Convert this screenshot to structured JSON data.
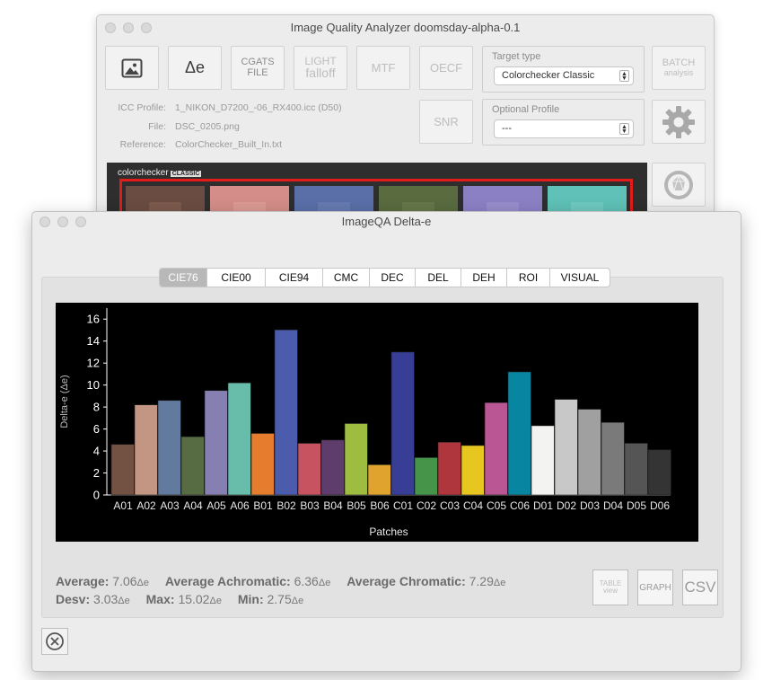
{
  "main_window": {
    "title": "Image Quality Analyzer doomsday-alpha-0.1",
    "toolbar": {
      "deltae_label": "Δe",
      "cgats_line1": "CGATS",
      "cgats_line2": "FILE",
      "light_line1": "LIGHT",
      "light_line2": "falloff",
      "mtf_label": "MTF",
      "oecf_label": "OECF",
      "snr_label": "SNR",
      "batch_line1": "BATCH",
      "batch_line2": "analysis"
    },
    "target_type": {
      "label": "Target type",
      "value": "Colorchecker Classic"
    },
    "optional_profile": {
      "label": "Optional Profile",
      "value": "---"
    },
    "info": {
      "icc_label": "ICC Profile:",
      "icc_value": "1_NIKON_D7200_-06_RX400.icc (D50)",
      "file_label": "File:",
      "file_value": "DSC_0205.png",
      "ref_label": "Reference:",
      "ref_value": "ColorChecker_Built_In.txt"
    },
    "preview": {
      "brand": "colorchecker",
      "brand_tag": "CLASSIC"
    }
  },
  "deltae_window": {
    "title": "ImageQA Delta-e",
    "tabs": [
      "CIE76",
      "CIE00",
      "CIE94",
      "CMC",
      "DEC",
      "DEL",
      "DEH",
      "ROI",
      "VISUAL"
    ],
    "selected_tab": "CIE76",
    "stats": {
      "average_label": "Average:",
      "average_value": "7.06",
      "avg_achromatic_label": "Average Achromatic:",
      "avg_achromatic_value": "6.36",
      "avg_chromatic_label": "Average Chromatic:",
      "avg_chromatic_value": "7.29",
      "desv_label": "Desv:",
      "desv_value": "3.03",
      "max_label": "Max:",
      "max_value": "15.02",
      "min_label": "Min:",
      "min_value": "2.75",
      "unit": "Δe"
    },
    "buttons": {
      "table_line1": "TABLE",
      "table_line2": "view",
      "graph": "GRAPH",
      "csv": "CSV"
    }
  },
  "colors": {
    "accent_red": "#e21b1b",
    "chart_bg": "#000000"
  },
  "chart_data": {
    "type": "bar",
    "xlabel": "Patches",
    "ylabel": "Delta-e (Δe)",
    "ylim": [
      0,
      17
    ],
    "yticks": [
      0,
      2,
      4,
      6,
      8,
      10,
      12,
      14,
      16
    ],
    "grid": false,
    "categories": [
      "A01",
      "A02",
      "A03",
      "A04",
      "A05",
      "A06",
      "B01",
      "B02",
      "B03",
      "B04",
      "B05",
      "B06",
      "C01",
      "C02",
      "C03",
      "C04",
      "C05",
      "C06",
      "D01",
      "D02",
      "D03",
      "D04",
      "D05",
      "D06"
    ],
    "values": [
      4.6,
      8.2,
      8.6,
      5.3,
      9.5,
      10.2,
      5.6,
      15.02,
      4.7,
      5.0,
      6.5,
      2.75,
      13.0,
      3.4,
      4.8,
      4.5,
      8.4,
      11.2,
      6.3,
      8.7,
      7.8,
      6.6,
      4.7,
      4.1
    ],
    "colors": [
      "#735244",
      "#c29682",
      "#627a9d",
      "#576c43",
      "#8580b1",
      "#67bdaa",
      "#e67d2e",
      "#4b5cad",
      "#c6535f",
      "#5e3c6c",
      "#9dbc40",
      "#e0a32e",
      "#383d96",
      "#469449",
      "#af363c",
      "#e7c71f",
      "#bb5695",
      "#0885a1",
      "#f3f3f2",
      "#c8c8c8",
      "#a0a0a0",
      "#7a7a7a",
      "#555555",
      "#343434"
    ]
  }
}
